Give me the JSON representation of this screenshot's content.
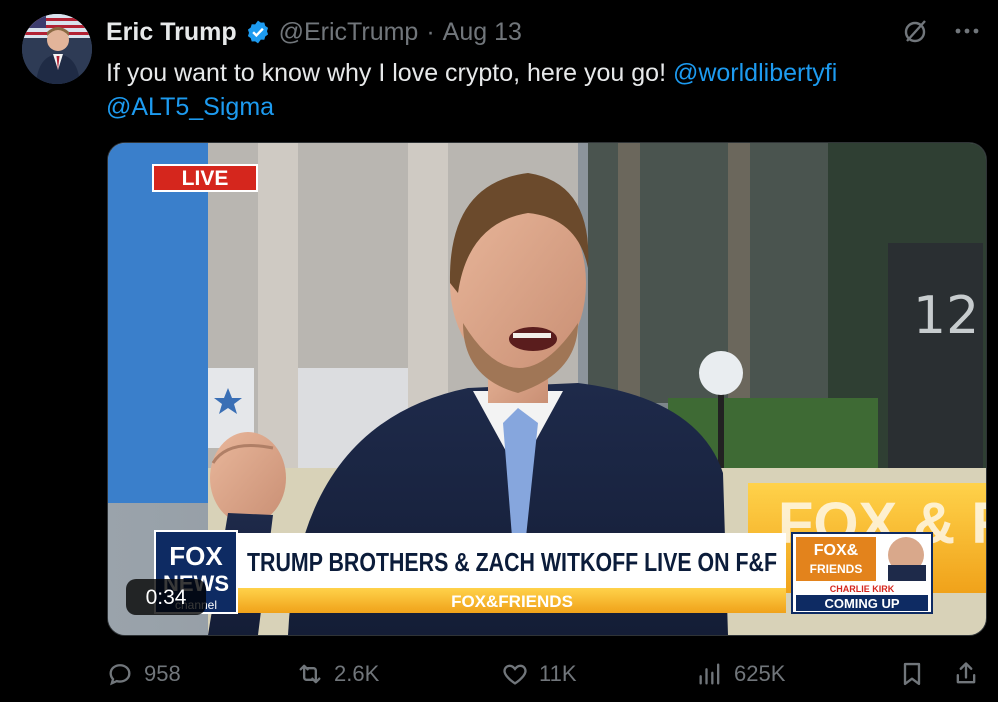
{
  "author": {
    "name": "Eric Trump",
    "handle": "@EricTrump",
    "separator": "·",
    "date": "Aug 13"
  },
  "tweet": {
    "text": "If you want to know why I love crypto, here you go! ",
    "mention1": "@worldlibertyfi",
    "mention2": "@ALT5_Sigma"
  },
  "video": {
    "duration": "0:34",
    "live_badge": "LIVE",
    "banner_text": "TRUMP BROTHERS & ZACH WITKOFF LIVE ON F&F",
    "sub_banner": "FOX&FRIENDS",
    "network_logo_line1": "FOX",
    "network_logo_line2": "NEWS",
    "network_logo_line3": "channel",
    "promo_title_line1": "FOX&",
    "promo_title_line2": "FRIENDS",
    "promo_name": "CHARLIE KIRK",
    "promo_coming": "COMING UP",
    "building_number": "12",
    "background_logo": "FOX & F"
  },
  "stats": {
    "replies": "958",
    "reposts": "2.6K",
    "likes": "11K",
    "views": "625K"
  },
  "colors": {
    "link": "#1d9bf0",
    "muted": "#71767b",
    "verified": "#1d9bf0"
  }
}
